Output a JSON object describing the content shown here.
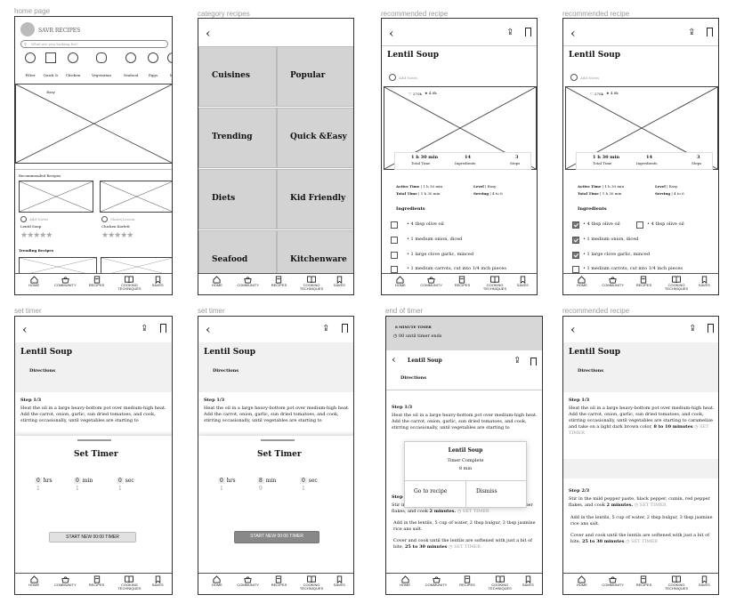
{
  "screen_labels": [
    "home page",
    "category recipes",
    "recommended recipe",
    "recommended recipe",
    "set timer",
    "set timer",
    "end of timer",
    "recommended recipe"
  ],
  "nav": [
    "HOME",
    "COMMUNITY",
    "RECIPES",
    "COOKING TECHNIQUES",
    "SAVES"
  ],
  "home": {
    "brand": "SAVR RECIPES",
    "search_placeholder": "What are you looking for?",
    "chips": [
      "Filter",
      "Quick & Easy",
      "Chicken",
      "Vegetarian",
      "Seafood",
      "Eggs",
      "Me"
    ],
    "recommended_title": "Recommended Recipes",
    "card1_name": "Lentil Soup",
    "card2_name": "Chicken Korlett",
    "card_meta": "Add Notes",
    "card2_meta": "Share/Lesson",
    "trending_title": "Trending Recipes"
  },
  "categories": [
    "Cuisines",
    "Popular",
    "Trending",
    "Quick &Easy",
    "Diets",
    "Kid Friendly",
    "Seafood",
    "Kitchenware"
  ],
  "recipe": {
    "title": "Lentil Soup",
    "add_notes": "Add Notes",
    "likes": "270k",
    "stars": "4.8k",
    "total_time": "1 h 30 min",
    "total_time_label": "Total Time",
    "ingredients_count": "14",
    "ingredients_label": "Ingredients",
    "steps_count": "3",
    "steps_label": "Steps",
    "active_time_label": "Active Time",
    "active_time": "1 h 30 min",
    "total_label": "Total Time",
    "total_value": "1 h 30 min",
    "level_label": "Level",
    "level": "Easy",
    "serving_label": "Serving",
    "serving": "4 to 6",
    "ingredients_title": "Ingredients",
    "ing1a": "4 tbsp olive oil",
    "ing1b": "4 tbsp olive oil",
    "ing2": "1 medium onion, diced",
    "ing3": "1 large clove garlic, minced",
    "ing4": "1 medium carrots, cut into 1/4 inch pieces"
  },
  "directions": {
    "title": "Directions",
    "step1": "Step 1/3",
    "step1_text": "Heat the oil in a large heavy-bottom pot over medium-high heat. Add the carrot, onion, garlic, sun dried tomatoes, and cook, stirring occasionally, until vegetables are starting to",
    "step1_more": "caramelize and take on a light dark brown color,",
    "step1_time": "8 to 10 minutes",
    "set_timer": "SET TIMER",
    "step2": "Step 2/3",
    "step2_text": "Stir in the mild pepper paste, black pepper, cumin, red pepper flakes, and cook",
    "step2_time": "2 minutes.",
    "step2b": "Add in the lentils, 5 cup of water, 2 tbsp bulgur, 3 tbsp jasmine rice ans salt.",
    "step2c": "Cover and cook until the lentils are softened with just a bit of bite,",
    "step2c_time": "25 to 30 minutes"
  },
  "timer": {
    "title": "Set Timer",
    "hrs": "hrs",
    "min": "min",
    "sec": "sec",
    "h0": "0",
    "m0": "0",
    "s0": "0",
    "h1": "1",
    "m1": "1",
    "s1": "1",
    "m8": "8",
    "m9": "9",
    "start": "START NEW 00:00 TIMER"
  },
  "endtimer": {
    "banner": "8 MINUTE TIMER",
    "until": "00 until timer ends",
    "popup_title": "Lentil Soup",
    "popup_sub": "Timer Complete",
    "popup_time": "8 min",
    "go": "Go to recipe",
    "dismiss": "Dismiss"
  }
}
